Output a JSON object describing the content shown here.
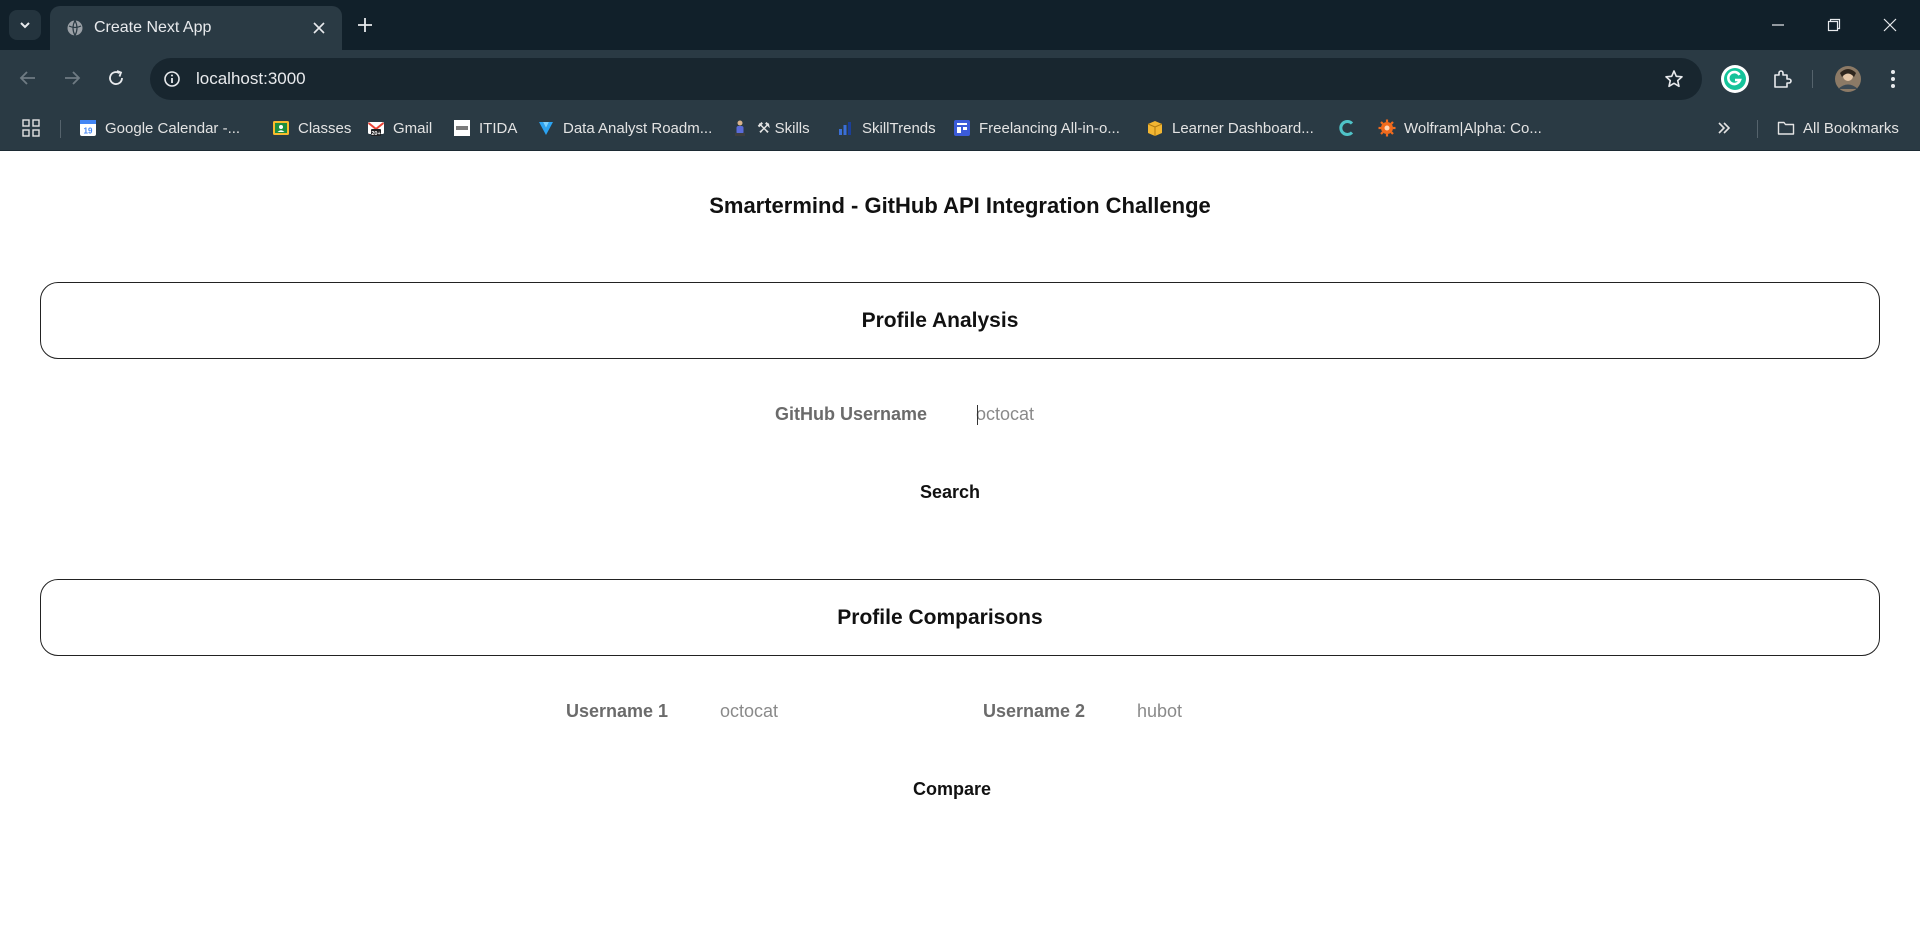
{
  "browser": {
    "tab_title": "Create Next App",
    "url": "localhost:3000",
    "colors": {
      "frame": "#11202a",
      "toolbar": "#2a3a44",
      "omnibox": "#18262f"
    }
  },
  "bookmarks": {
    "items": [
      {
        "label": "Google Calendar -...",
        "icon": "calendar-icon",
        "color": "#4285f4"
      },
      {
        "label": "Classes",
        "icon": "classroom-icon",
        "color": "#f9bb2d"
      },
      {
        "label": "Gmail",
        "icon": "gmail-icon",
        "color": "#ea4335"
      },
      {
        "label": "ITIDA",
        "icon": "itida-icon",
        "color": "#ffffff"
      },
      {
        "label": "Data Analyst Roadm...",
        "icon": "roadmap-icon",
        "color": "#2ba3f2"
      },
      {
        "label": "⚒ Skills",
        "icon": "skills-icon",
        "color": "#d0d0d0"
      },
      {
        "label": "SkillTrends",
        "icon": "bar-chart-icon",
        "color": "#3a6fd8"
      },
      {
        "label": "Freelancing All-in-o...",
        "icon": "freelancing-icon",
        "color": "#3b5bd9"
      },
      {
        "label": "Learner Dashboard...",
        "icon": "box-icon",
        "color": "#f2b632"
      },
      {
        "label": "",
        "icon": "c-logo-icon",
        "color": "#4fc3c8"
      },
      {
        "label": "Wolfram|Alpha: Co...",
        "icon": "wolfram-icon",
        "color": "#f26b1d"
      }
    ],
    "all_bookmarks": "All Bookmarks"
  },
  "page": {
    "title": "Smartermind - GitHub API Integration Challenge",
    "analysis": {
      "heading": "Profile Analysis",
      "username_label": "GitHub Username",
      "username_placeholder": "octocat",
      "search_label": "Search"
    },
    "comparison": {
      "heading": "Profile Comparisons",
      "username1_label": "Username 1",
      "username1_placeholder": "octocat",
      "username2_label": "Username 2",
      "username2_placeholder": "hubot",
      "compare_label": "Compare"
    }
  }
}
